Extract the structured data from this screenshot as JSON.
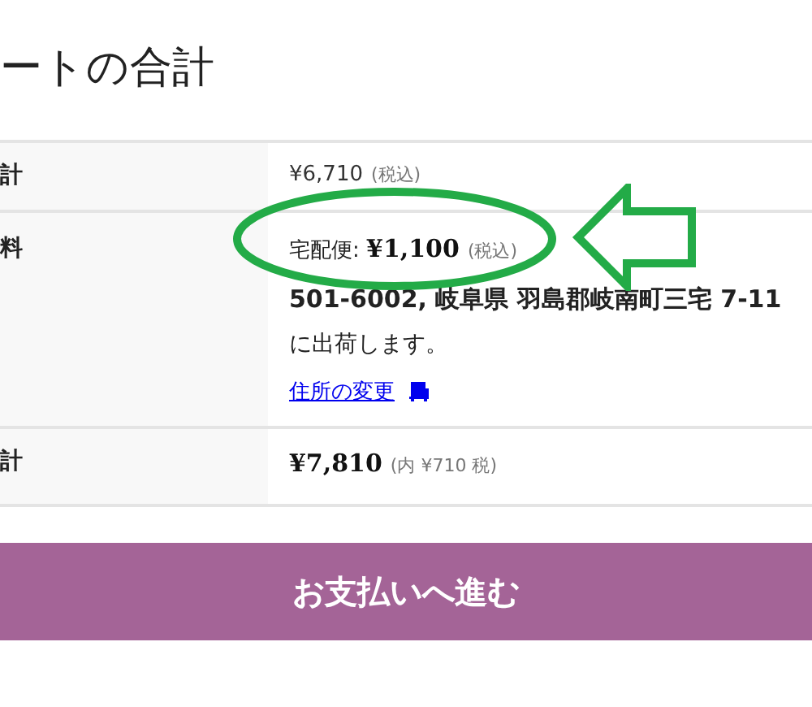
{
  "title": "ートの合計",
  "rows": [
    {
      "kind": "price",
      "label": "計",
      "amount": "¥6,710",
      "note": "(税込)"
    },
    {
      "kind": "shipping",
      "label": "料",
      "method": "宅配便: ",
      "amount": "¥1,100",
      "note": "(税込)",
      "destination": "501-6002, 岐阜県 羽島郡岐南町三宅 7-11",
      "destination_suffix": "に出荷します。",
      "link": "住所の変更"
    },
    {
      "kind": "total",
      "label": "計",
      "amount": "¥7,810",
      "note": "(内 ¥710 税)"
    }
  ],
  "checkout_button": "お支払いへ進む",
  "annotations": {
    "ellipse": {
      "color": "#23ab47"
    },
    "arrow": {
      "color": "#23ab47"
    }
  }
}
